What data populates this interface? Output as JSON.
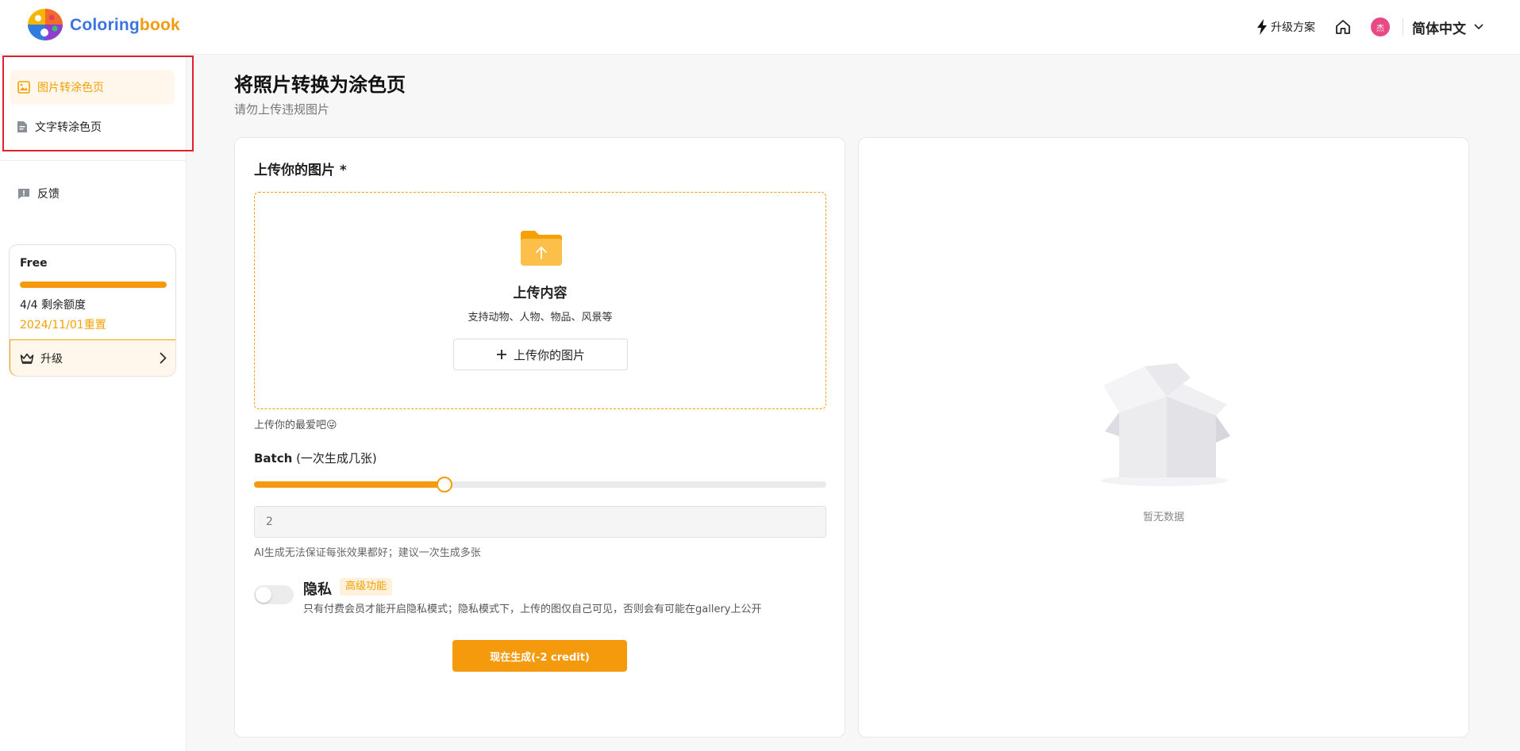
{
  "header": {
    "brand_part1": "Coloring",
    "brand_part2": "book",
    "upgrade_label": "升级方案",
    "avatar_initial": "杰",
    "language": "简体中文"
  },
  "sidebar": {
    "nav_items": [
      {
        "label": "图片转涂色页",
        "active": true
      },
      {
        "label": "文字转涂色页",
        "active": false
      }
    ],
    "feedback_label": "反馈",
    "plan": {
      "name": "Free",
      "quota_text": "4/4 剩余额度",
      "quota_fraction": 1.0,
      "reset_text": "2024/11/01重置",
      "upgrade_label": "升级"
    }
  },
  "main": {
    "title": "将照片转换为涂色页",
    "subtitle": "请勿上传违规图片",
    "upload": {
      "label": "上传你的图片 *",
      "drop_title": "上传内容",
      "drop_desc": "支持动物、人物、物品、风景等",
      "button_label": "上传你的图片",
      "hint": "上传你的最爱吧😜"
    },
    "batch": {
      "label_bold": "Batch",
      "label_rest": " (一次生成几张)",
      "value": "2",
      "slider_fraction": 0.333,
      "note": "AI生成无法保证每张效果都好；建议一次生成多张"
    },
    "privacy": {
      "title": "隐私",
      "badge": "高级功能",
      "desc": "只有付费会员才能开启隐私模式；隐私模式下，上传的图仅自己可见，否则会有可能在gallery上公开",
      "enabled": false
    },
    "generate_label": "现在生成(-2 credit)",
    "result": {
      "empty_text": "暂无数据"
    }
  },
  "colors": {
    "accent": "#f59a0c",
    "highlight_border": "#e0202d",
    "brand_blue": "#3b74e0"
  }
}
